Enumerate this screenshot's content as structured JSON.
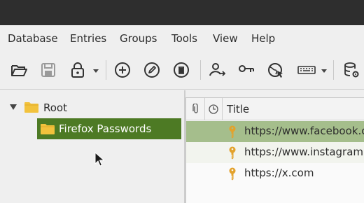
{
  "menubar": {
    "items": [
      "Database",
      "Entries",
      "Groups",
      "Tools",
      "View",
      "Help"
    ]
  },
  "toolbar": {
    "icons": [
      "open-database-icon",
      "save-database-icon",
      "lock-database-icon",
      "add-entry-icon",
      "edit-entry-icon",
      "delete-entry-icon",
      "copy-username-icon",
      "copy-password-icon",
      "open-url-icon",
      "autotype-keyboard-icon",
      "database-settings-icon"
    ]
  },
  "group_tree": {
    "root_label": "Root",
    "children": [
      {
        "label": "Firefox Passwords",
        "selected": true
      }
    ]
  },
  "entry_table": {
    "columns": {
      "attachment": "attachment-icon",
      "expiry": "clock-icon",
      "title": "Title"
    },
    "rows": [
      {
        "title": "https://www.facebook.com",
        "selected": true
      },
      {
        "title": "https://www.instagram.com",
        "selected": false
      },
      {
        "title": "https://x.com",
        "selected": false
      }
    ]
  },
  "colors": {
    "titlebar": "#2e2e2e",
    "selection_group": "#4d7a24",
    "selection_row": "#a5be8c",
    "folder": "#f2c23c",
    "key": "#e3a22c"
  }
}
